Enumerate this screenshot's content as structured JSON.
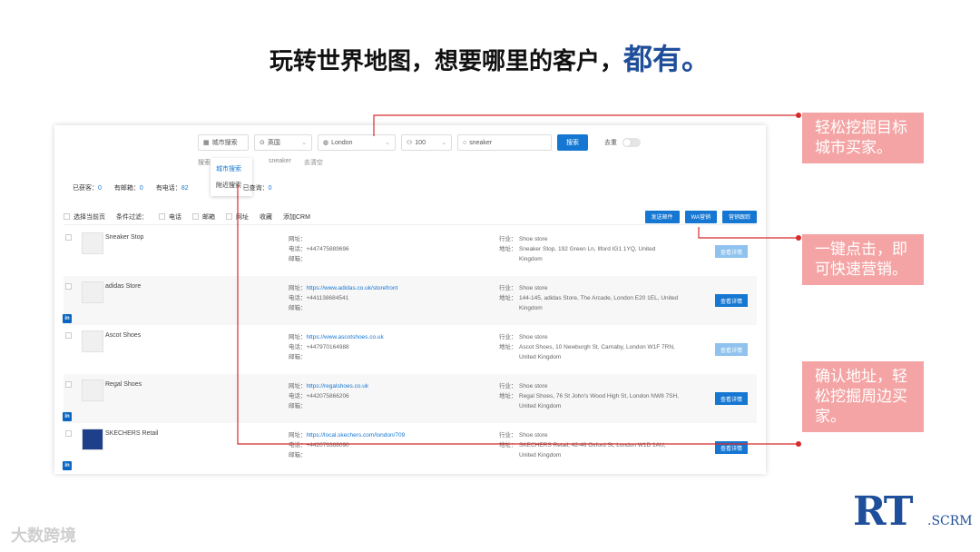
{
  "headline": {
    "main": "玩转世界地图，想要哪里的客户，",
    "accent": "都有。"
  },
  "toolbar": {
    "mode_select": "城市搜索",
    "country_select": "英国",
    "city_select": "London",
    "count_select": "100",
    "keyword_value": "sneaker",
    "search_button": "搜索",
    "dedupe_label": "去重"
  },
  "subrow": {
    "label": "搜索",
    "keyword": "sneaker",
    "clear": "去清空"
  },
  "dropdown": {
    "item1": "城市搜索",
    "item2": "附近搜索"
  },
  "stats": {
    "obtained_label": "已获客：",
    "obtained_value": "0",
    "email_label": "有邮箱：",
    "email_value": "0",
    "phone_label": "有电话：",
    "phone_value": "82",
    "queried_label": "已查询：",
    "queried_value": "0"
  },
  "filterbar": {
    "select_page": "选择当前页",
    "condition_filter": "条件过滤：",
    "phone": "电话",
    "email": "邮箱",
    "website": "网址",
    "favorite": "收藏",
    "add_crm": "添加CRM",
    "send_email": "发送邮件",
    "whatsapp": "WA营销",
    "marketing": "营销跟踪"
  },
  "labels": {
    "website": "网址：",
    "phone": "电话：",
    "email": "邮箱：",
    "industry": "行业：",
    "address": "地址：",
    "detail": "查看详情"
  },
  "rows": [
    {
      "name": "Sneaker Stop",
      "website": "",
      "phone": "+447475889696",
      "industry": "Shoe store",
      "address": "Sneaker Stop, 192 Green Ln, Ilford IG1 1YQ, United Kingdom"
    },
    {
      "name": "adidas Store",
      "website": "https://www.adidas.co.uk/storefront",
      "phone": "+441138684541",
      "industry": "Shoe store",
      "address": "144-145, adidas Store, The Arcade, London E20 1EL, United Kingdom"
    },
    {
      "name": "Ascot Shoes",
      "website": "https://www.ascotshoes.co.uk",
      "phone": "+447970164988",
      "industry": "Shoe store",
      "address": "Ascot Shoes, 10 Newburgh St, Carnaby, London W1F 7RN, United Kingdom"
    },
    {
      "name": "Regal Shoes",
      "website": "https://regalshoes.co.uk",
      "phone": "+442075866206",
      "industry": "Shoe store",
      "address": "Regal Shoes, 76 St John's Wood High St, London NW8 7SH, United Kingdom"
    },
    {
      "name": "SKECHERS Retail",
      "website": "https://local.skechers.com/london/709",
      "phone": "+442076368090",
      "industry": "Shoe store",
      "address": "SKECHERS Retail, 42-46 Oxford St, London W1D 1AU, United Kingdom"
    }
  ],
  "callouts": {
    "c1": "轻松挖掘目标城市买家。",
    "c2": "一键点击，即可快速营销。",
    "c3": "确认地址，轻松挖掘周边买家。"
  },
  "logo": {
    "rt": "RT",
    "scrm": ".SCRM"
  },
  "watermark": "大数跨境",
  "colors": {
    "accent": "#1677d2",
    "callout": "#f4a4a4",
    "line": "#d62b2b",
    "brand": "#1f4e9a"
  }
}
